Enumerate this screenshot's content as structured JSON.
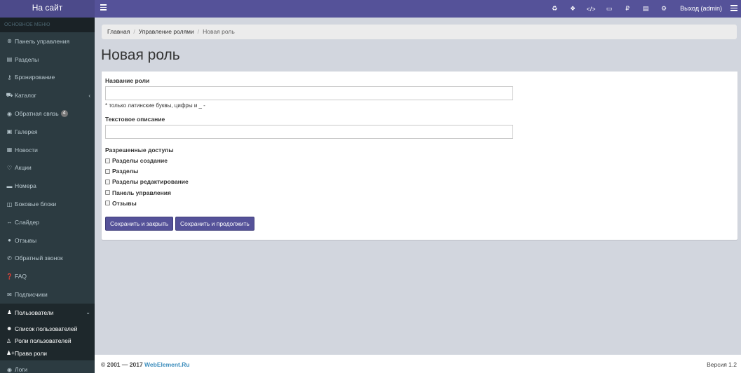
{
  "topbar": {
    "logo": "На сайт",
    "icons": [
      "refresh-icon",
      "cubes-icon",
      "code-icon",
      "monitor-icon",
      "ruble-icon",
      "file-icon",
      "cogs-icon"
    ],
    "logout": "Выход (admin)"
  },
  "sidebar": {
    "header": "ОСНОВНОЕ МЕНЮ",
    "items": [
      {
        "label": "Панель управления",
        "icon": "dashboard-icon",
        "glyph": "⊛"
      },
      {
        "label": "Разделы",
        "icon": "file-icon",
        "glyph": "▤"
      },
      {
        "label": "Бронирование",
        "icon": "key-icon",
        "glyph": "⚷"
      },
      {
        "label": "Каталог",
        "icon": "cart-icon",
        "glyph": "⛟",
        "chevron": "‹"
      },
      {
        "label": "Обратная связь",
        "icon": "comments-icon",
        "glyph": "◉",
        "badge": "4"
      },
      {
        "label": "Галерея",
        "icon": "image-icon",
        "glyph": "▣"
      },
      {
        "label": "Новости",
        "icon": "newspaper-icon",
        "glyph": "▦"
      },
      {
        "label": "Акции",
        "icon": "heart-icon",
        "glyph": "♡"
      },
      {
        "label": "Номера",
        "icon": "bed-icon",
        "glyph": "▬"
      },
      {
        "label": "Боковые блоки",
        "icon": "blocks-icon",
        "glyph": "◫"
      },
      {
        "label": "Слайдер",
        "icon": "arrows-h-icon",
        "glyph": "↔"
      },
      {
        "label": "Отзывы",
        "icon": "comment-icon",
        "glyph": "●"
      },
      {
        "label": "Обратный звонок",
        "icon": "phone-icon",
        "glyph": "✆"
      },
      {
        "label": "FAQ",
        "icon": "question-icon",
        "glyph": "❓"
      },
      {
        "label": "Подписчики",
        "icon": "envelope-icon",
        "glyph": "✉"
      },
      {
        "label": "Пользователи",
        "icon": "user-icon",
        "glyph": "♟",
        "chevron": "⌄",
        "active": true
      }
    ],
    "subitems": [
      {
        "label": "Список пользователей",
        "icon": "users-icon",
        "glyph": "☻"
      },
      {
        "label": "Роли пользователей",
        "icon": "user-secret-icon",
        "glyph": "♙"
      },
      {
        "label": "Права роли",
        "icon": "user-plus-icon",
        "glyph": "♟+"
      }
    ],
    "last": {
      "label": "Логи",
      "icon": "eye-icon",
      "glyph": "◉"
    }
  },
  "breadcrumb": {
    "home": "Главная",
    "parent": "Управление ролями",
    "current": "Новая роль",
    "separator": "/"
  },
  "page_title": "Новая роль",
  "form": {
    "role_name_label": "Название роли",
    "role_name_value": "",
    "role_name_hint": "* только латинские буквы, цифры и _ -",
    "description_label": "Текстовое описание",
    "description_value": "",
    "permissions_label": "Разрешенные доступы",
    "permissions": [
      {
        "label": "Разделы создание",
        "checked": false
      },
      {
        "label": "Разделы",
        "checked": false
      },
      {
        "label": "Разделы редактирование",
        "checked": false
      },
      {
        "label": "Панель управления",
        "checked": false
      },
      {
        "label": "Отзывы",
        "checked": false
      }
    ],
    "save_close": "Сохранить и закрыть",
    "save_continue": "Сохранить и продолжить"
  },
  "footer": {
    "copyright": "© 2001 — 2017 ",
    "brand": "WebElement.Ru",
    "version": "Версия 1.2"
  },
  "colors": {
    "accent": "#555299",
    "sidebar_bg": "#2c3b41",
    "content_bg": "#d2d6de"
  }
}
